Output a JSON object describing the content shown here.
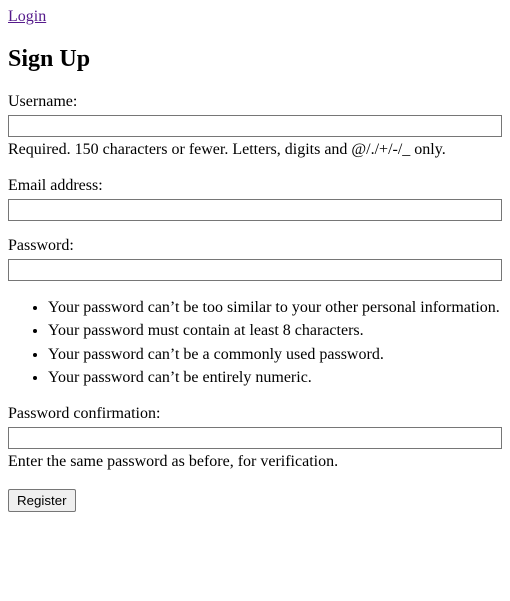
{
  "nav": {
    "login_link": "Login"
  },
  "heading": "Sign Up",
  "fields": {
    "username": {
      "label": "Username:",
      "help": "Required. 150 characters or fewer. Letters, digits and @/./+/-/_ only."
    },
    "email": {
      "label": "Email address:"
    },
    "password": {
      "label": "Password:",
      "rules": [
        "Your password can’t be too similar to your other personal information.",
        "Your password must contain at least 8 characters.",
        "Your password can’t be a commonly used password.",
        "Your password can’t be entirely numeric."
      ]
    },
    "password_confirm": {
      "label": "Password confirmation:",
      "help": "Enter the same password as before, for verification."
    }
  },
  "actions": {
    "submit_label": "Register"
  }
}
